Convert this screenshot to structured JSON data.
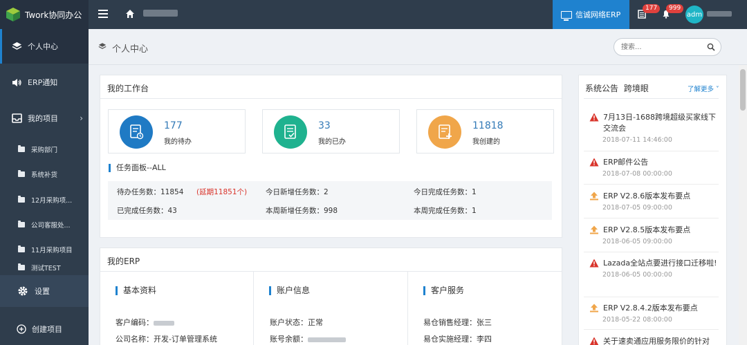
{
  "app": {
    "logo_text": "Twork协同办公",
    "erp_button": "信诚网络ERP",
    "notifications": {
      "list_badge": "177",
      "bell_badge": "999"
    },
    "avatar_text": "adm"
  },
  "sidebar": {
    "items": [
      {
        "label": "个人中心",
        "icon": "layers-icon"
      },
      {
        "label": "ERP通知",
        "icon": "speaker-icon"
      },
      {
        "label": "我的项目",
        "icon": "inbox-icon"
      }
    ],
    "projects": [
      "采购部门",
      "系统补货",
      "12月采购项...",
      "公司客服处...",
      "11月采购项目",
      "测试TEST"
    ],
    "settings_label": "设置",
    "create_label": "创建项目"
  },
  "header": {
    "page_title": "个人中心",
    "search_placeholder": "搜索..."
  },
  "workbench": {
    "title": "我的工作台",
    "cards": [
      {
        "value": "177",
        "label": "我的待办",
        "color": "#1f7ac4"
      },
      {
        "value": "33",
        "label": "我的已办",
        "color": "#1fb28f"
      },
      {
        "value": "11818",
        "label": "我创建的",
        "color": "#f0a64a"
      }
    ],
    "task_panel_title": "任务面板--ALL",
    "tasks": {
      "pending": "待办任务数：11854",
      "overdue": "(延期11851个)",
      "today_new": "今日新增任务数：2",
      "today_done": "今日完成任务数：1",
      "completed": "已完成任务数：43",
      "week_new": "本周新增任务数：998",
      "week_done": "本周完成任务数：1"
    }
  },
  "my_erp": {
    "title": "我的ERP",
    "basic": {
      "title": "基本资料",
      "customer_code": "客户编码：",
      "company": "公司名称：开发-订单管理系统"
    },
    "account": {
      "title": "账户信息",
      "status": "账户状态：正常",
      "balance": "账号余额："
    },
    "service": {
      "title": "客户服务",
      "sales": "易仓销售经理：张三",
      "impl": "易仓实施经理：李四"
    }
  },
  "announcements": {
    "tabs": [
      "系统公告",
      "跨境眼"
    ],
    "more": "了解更多",
    "items": [
      {
        "title": "7月13日-1688跨境超级买家线下交流会",
        "date": "2018-07-11 14:46:00",
        "icon": "warning-icon"
      },
      {
        "title": "ERP邮件公告",
        "date": "2018-07-08 00:00:00",
        "icon": "warning-icon"
      },
      {
        "title": "ERP V2.8.6版本发布要点",
        "date": "2018-07-05 09:00:00",
        "icon": "upload-icon"
      },
      {
        "title": "ERP V2.8.5版本发布要点",
        "date": "2018-06-05 09:00:00",
        "icon": "upload-icon"
      },
      {
        "title": "Lazada全站点要进行接口迁移啦!",
        "date": "2018-06-05 00:00:00",
        "icon": "warning-icon"
      },
      {
        "title": "ERP V2.8.4.2版本发布要点",
        "date": "2018-05-22 08:00:00",
        "icon": "upload-icon"
      },
      {
        "title": "关于速卖通应用服务限价的针对",
        "date": "",
        "icon": "warning-icon"
      }
    ]
  },
  "colors": {
    "topbar": "#2f3d4c",
    "accent": "#1f82cf",
    "danger": "#d9342b"
  }
}
